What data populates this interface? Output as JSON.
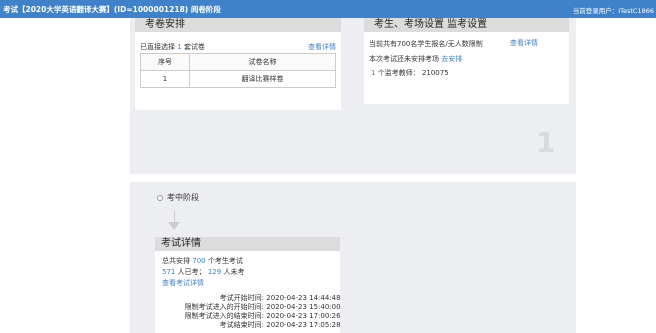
{
  "header": {
    "title": "考试【2020大学英语翻译大赛】(ID=1000001218) 阅卷阶段",
    "user_label": "当前登录用户：",
    "user_name": "ITestC1866"
  },
  "exam_arrangement": {
    "title": "考卷安排",
    "selected_prefix": "已直接选择",
    "selected_count": "1",
    "selected_suffix": "套试卷",
    "view_details": "查看详情",
    "table": {
      "headers": [
        "序号",
        "试卷名称"
      ],
      "rows": [
        [
          "1",
          "翻译比赛样卷"
        ]
      ]
    }
  },
  "venue_settings": {
    "title": "考生、考场设置 监考设置",
    "view_details": "查看详情",
    "line1": "当前共有700名学生报名/无人数限制",
    "line2_prefix": "本次考试还未安排考场",
    "line2_link": "去安排",
    "proctor_count": "1",
    "proctor_text": "个监考教师：",
    "proctor_id": "210075"
  },
  "stage_number": "1",
  "stage2": {
    "label": "考中阶段",
    "details": {
      "title": "考试详情",
      "arranged_prefix": "总共安排",
      "arranged_count": "700",
      "arranged_suffix": "个考生考试",
      "taken_count": "571",
      "taken_text": "人已考；",
      "not_taken_count": "129",
      "not_taken_text": "人未考",
      "view_details": "查看考试详情",
      "times": [
        {
          "label": "考试开始时间:",
          "value": "2020-04-23 14:44:48"
        },
        {
          "label": "限制考试进入的开始时间:",
          "value": "2020-04-23 15:40:00"
        },
        {
          "label": "限制考试进入的结束时间:",
          "value": "2020-04-23 17:00:26"
        },
        {
          "label": "考试结束时间:",
          "value": "2020-04-23 17:05:28"
        }
      ]
    }
  }
}
